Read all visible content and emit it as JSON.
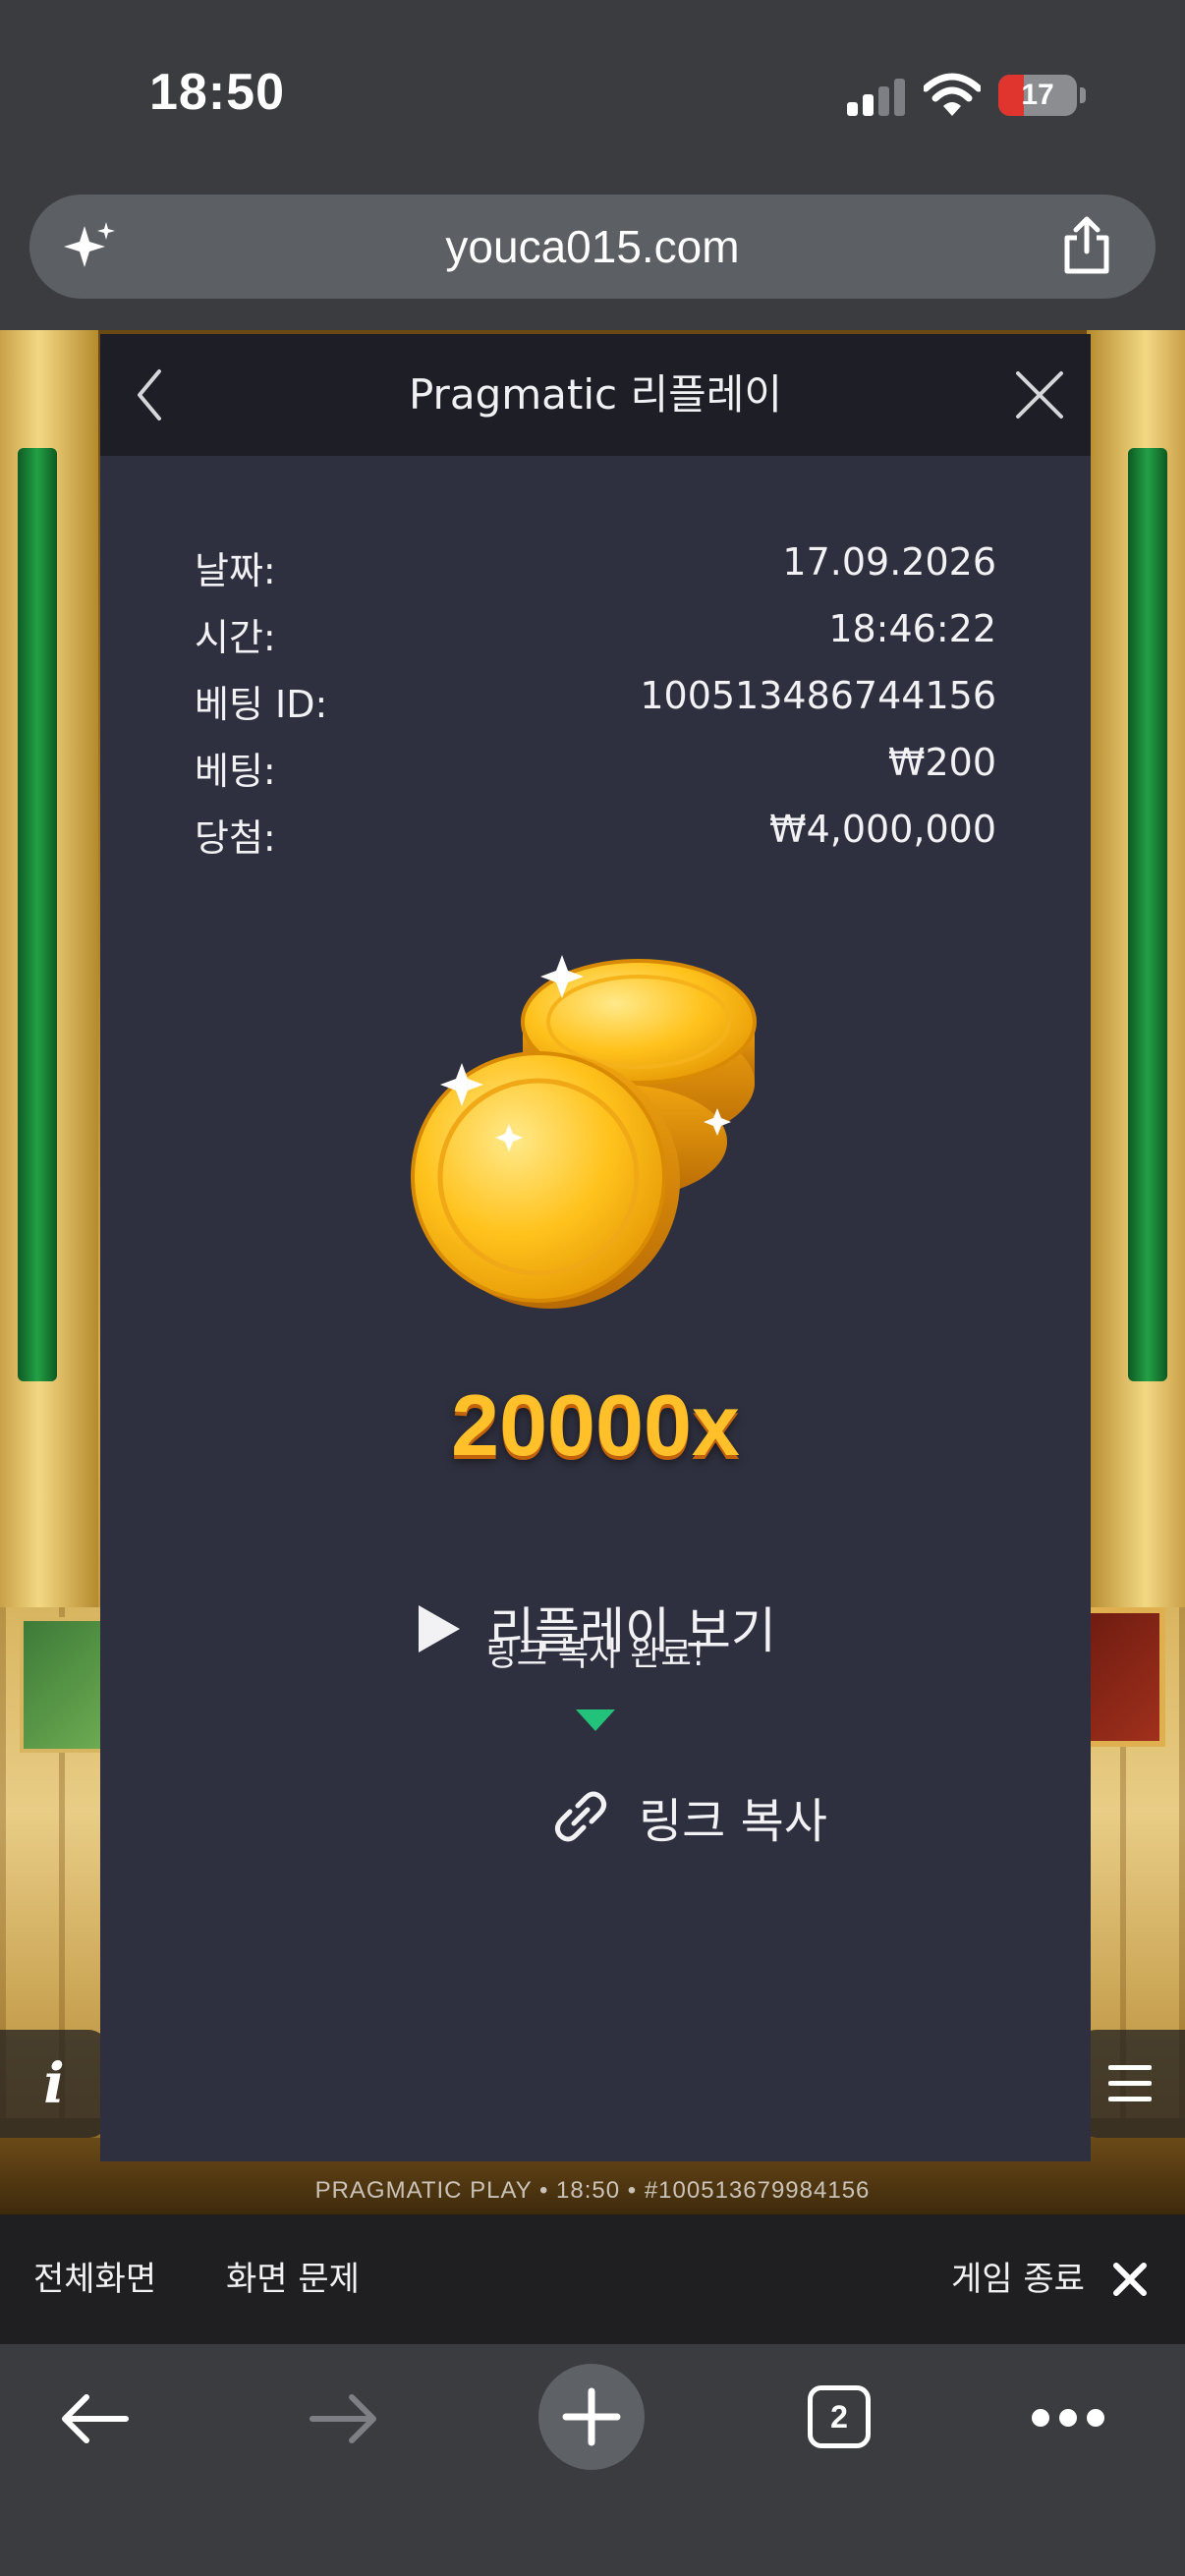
{
  "status_bar": {
    "time": "18:50",
    "battery": "17",
    "battery_color": "#e0342e"
  },
  "url_bar": {
    "url": "youca015.com"
  },
  "game": {
    "footer_text": "PRAGMATIC PLAY • 18:50 • #100513679984156",
    "info_label": "i"
  },
  "modal": {
    "title": "Pragmatic 리플레이",
    "rows": [
      {
        "label": "날짜:",
        "value": "17.09.2026"
      },
      {
        "label": "시간:",
        "value": "18:46:22"
      },
      {
        "label": "베팅 ID:",
        "value": "100513486744156"
      },
      {
        "label": "베팅:",
        "value": "₩200"
      },
      {
        "label": "당첨:",
        "value": "₩4,000,000"
      }
    ],
    "multiplier": "20000x",
    "replay_label": "리플레이 보기",
    "toast": "링크 복사 완료!",
    "toast_color": "#22c27a",
    "copy_link_label": "링크 복사",
    "accent_color": "#ffc02a"
  },
  "game_bar": {
    "fullscreen": "전체화면",
    "screen_issue": "화면 문제",
    "exit_game": "게임 종료"
  },
  "toolbar": {
    "tab_count": "2"
  }
}
